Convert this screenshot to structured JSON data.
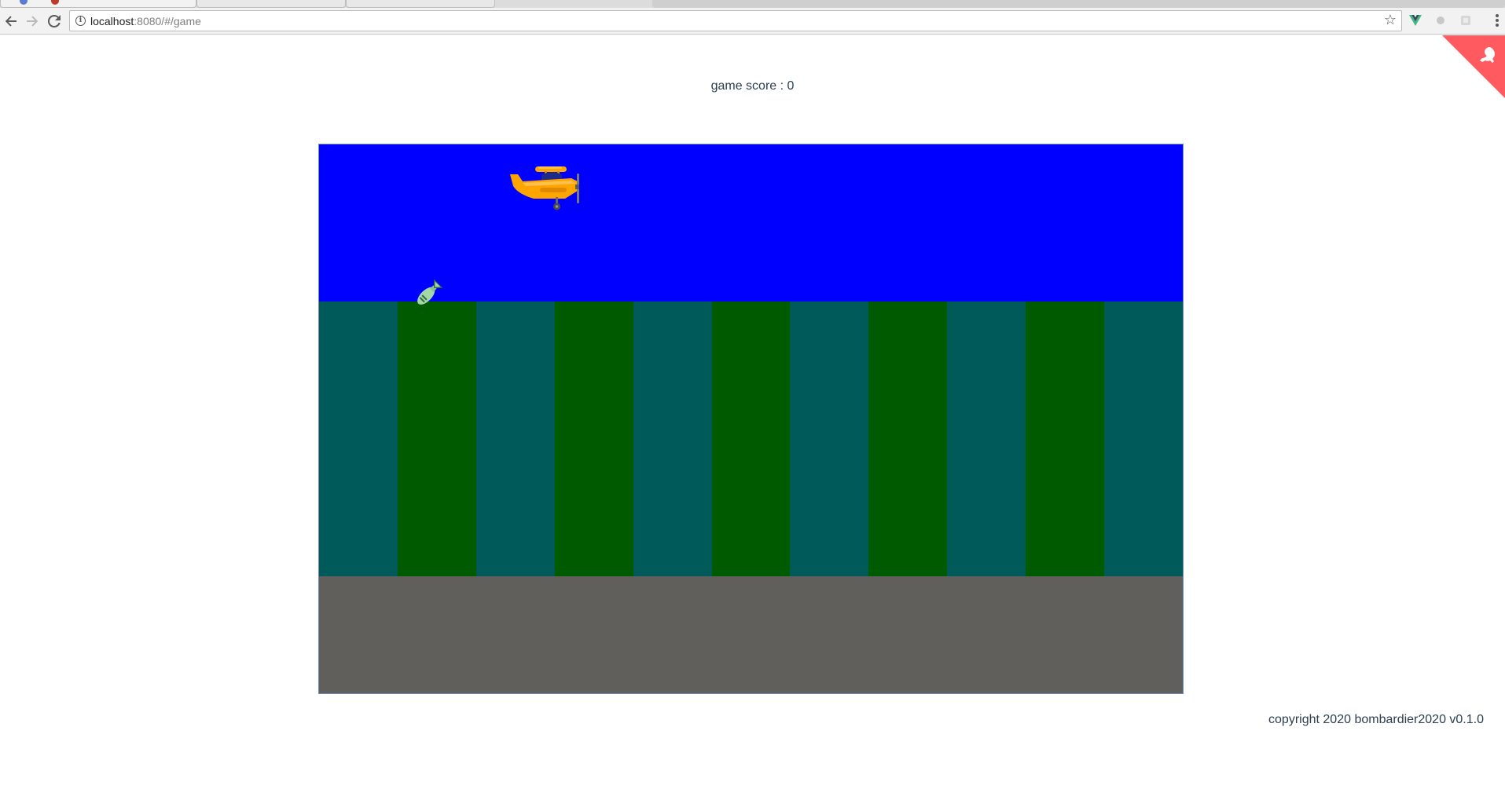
{
  "browser": {
    "url_host": "localhost",
    "url_rest": ":8080/#/game"
  },
  "game": {
    "score_text": "game score : 0",
    "colors": {
      "sky": "#0000ff",
      "stripe_teal": "#005a5a",
      "stripe_green": "#005a00",
      "ground": "#615f5c",
      "plane": "#ffa500",
      "bomb": "#a5d6a7",
      "corner": "#ff5a5f"
    },
    "stripes": [
      "teal",
      "green",
      "teal",
      "green",
      "teal",
      "green",
      "teal",
      "green",
      "teal",
      "green",
      "teal"
    ]
  },
  "footer": {
    "copyright": "copyright 2020 bombardier2020 v0.1.0"
  },
  "icons": [
    "back-icon",
    "forward-icon",
    "reload-icon",
    "info-icon",
    "star-icon",
    "vue-devtools-icon",
    "extension-icon",
    "extension-icon-2",
    "menu-icon",
    "github-corner-icon",
    "plane-icon",
    "bomb-icon"
  ]
}
